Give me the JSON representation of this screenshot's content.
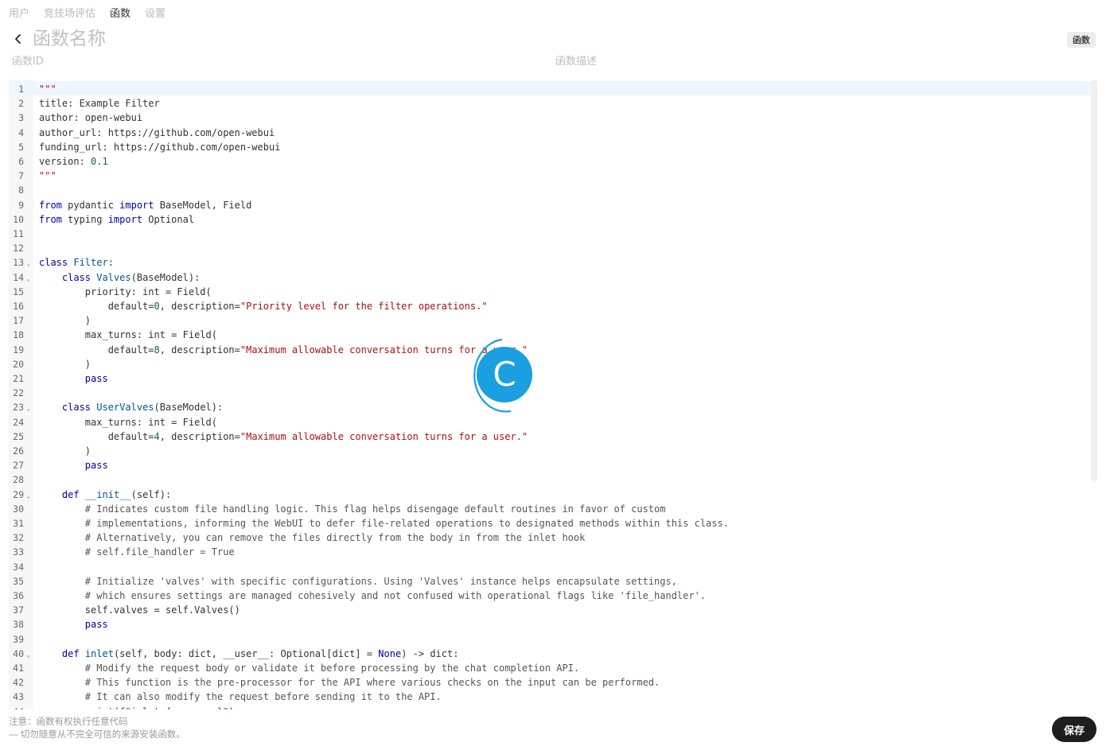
{
  "nav": {
    "tabs": [
      {
        "label": "用户"
      },
      {
        "label": "竞技场评估"
      },
      {
        "label": "函数"
      },
      {
        "label": "设置"
      }
    ],
    "active_index": 2
  },
  "header": {
    "name_placeholder": "函数名称",
    "type_badge": "函数"
  },
  "meta": {
    "id_placeholder": "函数ID",
    "description_placeholder": "函数描述"
  },
  "editor": {
    "lines": [
      "\"\"\"",
      "title: Example Filter",
      "author: open-webui",
      "author_url: https://github.com/open-webui",
      "funding_url: https://github.com/open-webui",
      "version: 0.1",
      "\"\"\"",
      "",
      "from pydantic import BaseModel, Field",
      "from typing import Optional",
      "",
      "",
      "class Filter:",
      "    class Valves(BaseModel):",
      "        priority: int = Field(",
      "            default=0, description=\"Priority level for the filter operations.\"",
      "        )",
      "        max_turns: int = Field(",
      "            default=8, description=\"Maximum allowable conversation turns for a user.\"",
      "        )",
      "        pass",
      "",
      "    class UserValves(BaseModel):",
      "        max_turns: int = Field(",
      "            default=4, description=\"Maximum allowable conversation turns for a user.\"",
      "        )",
      "        pass",
      "",
      "    def __init__(self):",
      "        # Indicates custom file handling logic. This flag helps disengage default routines in favor of custom",
      "        # implementations, informing the WebUI to defer file-related operations to designated methods within this class.",
      "        # Alternatively, you can remove the files directly from the body in from the inlet hook",
      "        # self.file_handler = True",
      "",
      "        # Initialize 'valves' with specific configurations. Using 'Valves' instance helps encapsulate settings,",
      "        # which ensures settings are managed cohesively and not confused with operational flags like 'file_handler'.",
      "        self.valves = self.Valves()",
      "        pass",
      "",
      "    def inlet(self, body: dict, __user__: Optional[dict] = None) -> dict:",
      "        # Modify the request body or validate it before processing by the chat completion API.",
      "        # This function is the pre-processor for the API where various checks on the input can be performed.",
      "        # It can also modify the request before sending it to the API.",
      "        print(f\"inlet:{__name__}\")"
    ],
    "fold_lines": [
      13,
      14,
      23,
      29,
      40
    ]
  },
  "loader": {
    "glyph": "C",
    "color": "#1a9fe0"
  },
  "footer": {
    "warning_line1": "注意：函数有权执行任意代码",
    "warning_line2": "— 切勿随意从不完全可信的来源安装函数。",
    "save_label": "保存"
  }
}
